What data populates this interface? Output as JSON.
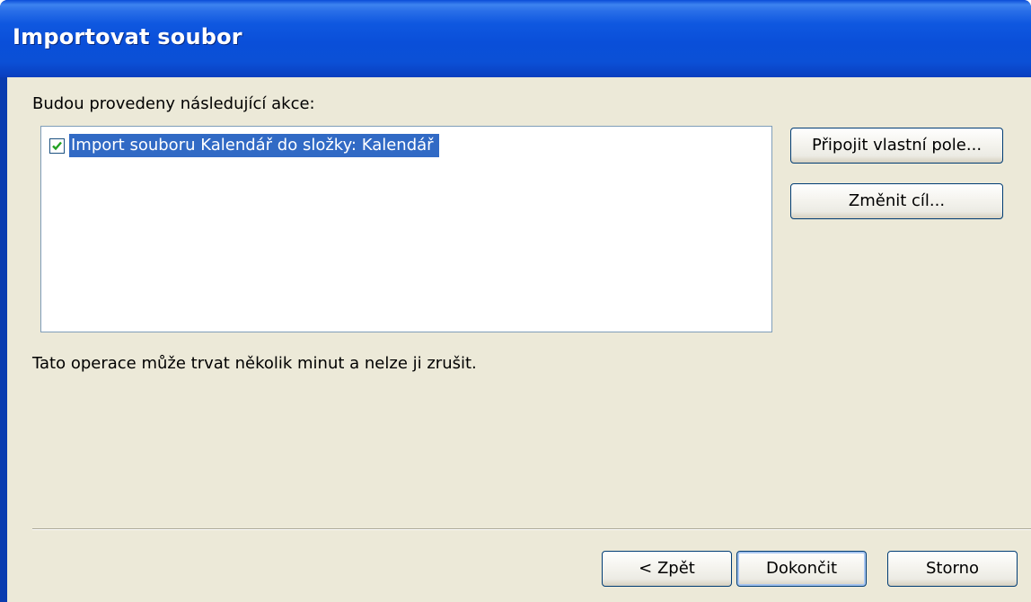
{
  "window": {
    "title": "Importovat soubor"
  },
  "actions_label": "Budou provedeny následující akce:",
  "action_list": [
    {
      "label": "Import souboru Kalendář do složky: Kalendář",
      "checked": true,
      "selected": true
    }
  ],
  "side_buttons": {
    "map_custom_fields": "Připojit vlastní pole...",
    "change_destination": "Změnit cíl..."
  },
  "info_text": "Tato operace může trvat několik minut a nelze ji zrušit.",
  "footer_buttons": {
    "back": "< Zpět",
    "finish": "Dokončit",
    "cancel": "Storno"
  },
  "colors": {
    "titlebar": "#0a4fd9",
    "client_bg": "#ece9d8",
    "selection": "#316ac5",
    "list_border": "#7f9db9"
  }
}
